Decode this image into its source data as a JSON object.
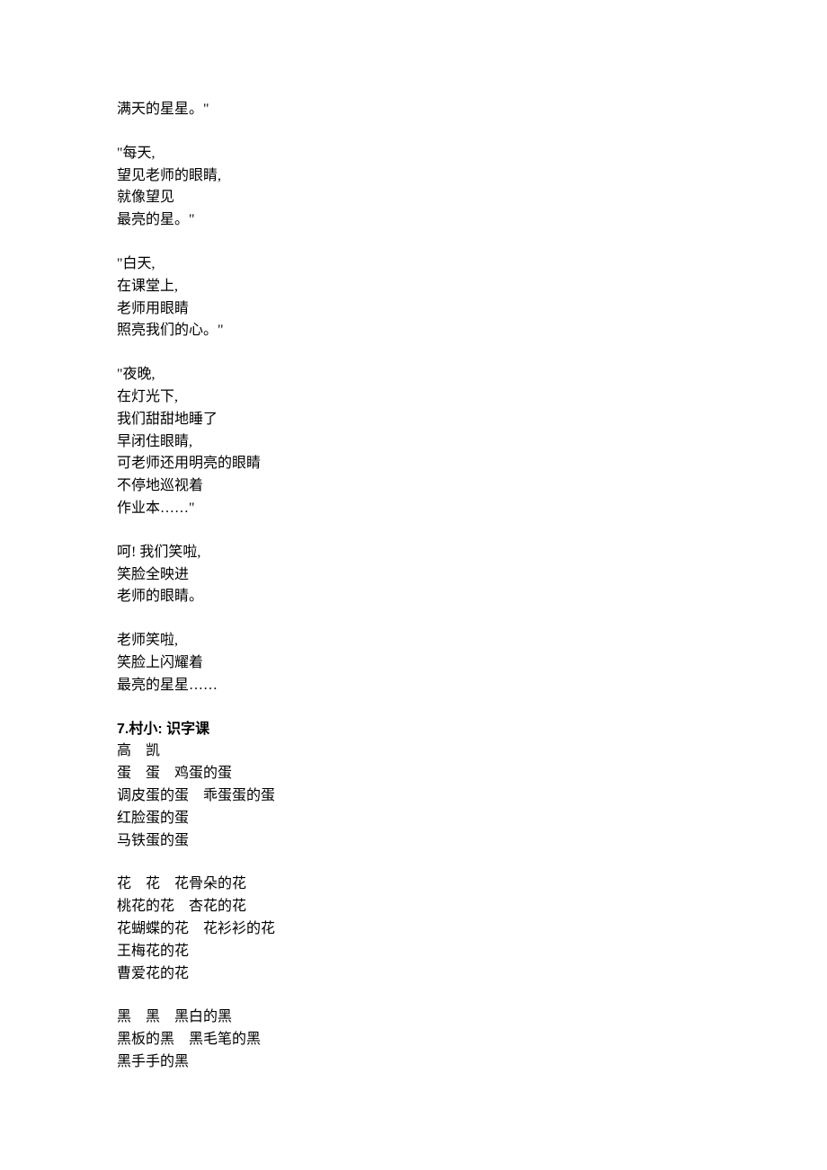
{
  "stanzas": [
    {
      "lines": [
        "满天的星星。\""
      ]
    },
    {
      "lines": [
        "\"每天,",
        "望见老师的眼睛,",
        "就像望见",
        "最亮的星。\""
      ]
    },
    {
      "lines": [
        "\"白天,",
        "在课堂上,",
        "老师用眼睛",
        "照亮我们的心。\""
      ]
    },
    {
      "lines": [
        "\"夜晚,",
        "在灯光下,",
        "我们甜甜地睡了",
        "早闭住眼睛,",
        "可老师还用明亮的眼睛",
        "不停地巡视着",
        "作业本……\""
      ]
    },
    {
      "lines": [
        "呵! 我们笑啦,",
        "笑脸全映进",
        "老师的眼睛。"
      ]
    },
    {
      "lines": [
        "老师笑啦,",
        "笑脸上闪耀着",
        "最亮的星星……"
      ]
    }
  ],
  "section": {
    "heading": "7.村小: 识字课",
    "author": "高　凯",
    "stanzas": [
      {
        "lines": [
          "蛋　蛋　鸡蛋的蛋",
          "调皮蛋的蛋　乖蛋蛋的蛋",
          "红脸蛋的蛋",
          "马铁蛋的蛋"
        ]
      },
      {
        "lines": [
          "花　花　花骨朵的花",
          "桃花的花　杏花的花",
          "花蝴蝶的花　花衫衫的花",
          "王梅花的花",
          "曹爱花的花"
        ]
      },
      {
        "lines": [
          "黑　黑　黑白的黑",
          "黑板的黑　黑毛笔的黑",
          "黑手手的黑"
        ]
      }
    ]
  }
}
